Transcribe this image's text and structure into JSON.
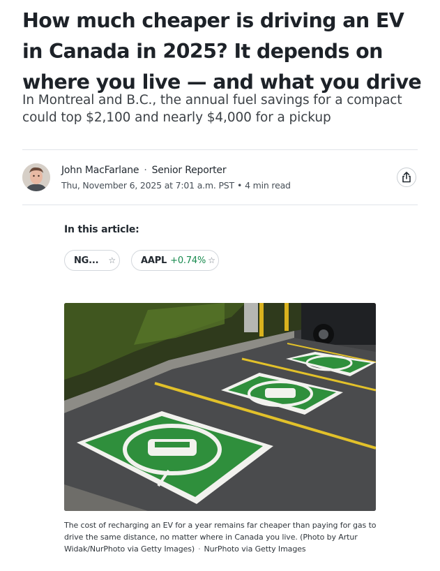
{
  "article": {
    "headline": "How much cheaper is driving an EV in Canada in 2025? It depends on where you live — and what you drive",
    "subheadline": "In Montreal and B.C., the annual fuel savings for a compact could top $2,100 and nearly $4,000 for a pickup"
  },
  "author": {
    "name": "John MacFarlane",
    "separator": "·",
    "title": "Senior Reporter",
    "date": "Thu, November 6, 2025 at 7:01 a.m. PST",
    "meta_separator": "•",
    "read_time": "4 min read"
  },
  "icons": {
    "share": "share-icon",
    "star": "star-outline-icon"
  },
  "in_article": {
    "label": "In this article:",
    "tickers": [
      {
        "symbol": "NG...",
        "change": ""
      },
      {
        "symbol": "AAPL",
        "change": "+0.74%"
      }
    ],
    "star_glyph": "☆",
    "positive_color": "#178a4e"
  },
  "photo": {
    "caption": "The cost of recharging an EV for a year remains far cheaper than paying for gas to drive the same distance, no matter where in Canada you live. (Photo by Artur Widak/NurPhoto via Getty Images)",
    "caption_separator": "·",
    "credit": "NurPhoto via Getty Images"
  }
}
